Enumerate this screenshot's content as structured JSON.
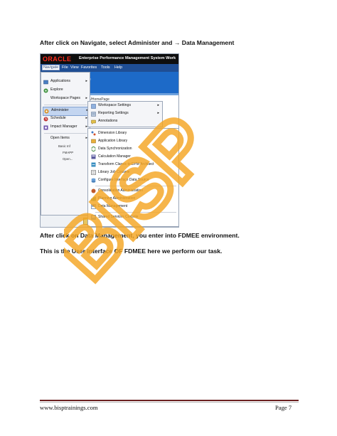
{
  "doc": {
    "para1": "After click on Navigate, select Administer and  → Data Management",
    "para2": "After click on Data Management, you enter into FDMEE environment.",
    "para3": "This is the User interface OF FDMEE here we perform our task."
  },
  "shot": {
    "brand": "ORACLE",
    "app_title": "Enterprise Performance Management System Work",
    "menubar": [
      "Navigate",
      "File",
      "View",
      "Favorites",
      "Tools",
      "Help"
    ],
    "blue_fragment": "e",
    "homepage_fragment": "s/HomePage",
    "navigate_menu": [
      {
        "label": "Applications",
        "icon": "applications-icon",
        "has_sub": true
      },
      {
        "label": "Explore",
        "icon": "explore-icon",
        "has_sub": false
      },
      {
        "label": "Workspace Pages",
        "icon": "",
        "has_sub": true
      },
      {
        "label": "Administer",
        "icon": "administer-icon",
        "has_sub": true
      },
      {
        "label": "Schedule",
        "icon": "schedule-icon",
        "has_sub": true
      },
      {
        "label": "Impact Manager",
        "icon": "impact-manager-icon",
        "has_sub": true
      },
      {
        "label": "Open Items",
        "icon": "",
        "has_sub": true
      }
    ],
    "open_windows": [
      "Basic Inf",
      "FMAPP",
      "Open..."
    ],
    "administer_submenu": [
      {
        "label": "Workspace Settings",
        "icon": "workspace-settings-icon",
        "has_sub": true
      },
      {
        "label": "Reporting Settings",
        "icon": "reporting-settings-icon",
        "has_sub": true
      },
      {
        "label": "Annotations",
        "icon": "annotations-icon",
        "has_sub": false
      }
    ],
    "third_menu": [
      {
        "label": "Dimension Library",
        "icon": "dimension-library-icon"
      },
      {
        "label": "Application Library",
        "icon": "application-library-icon"
      },
      {
        "label": "Data Synchronization",
        "icon": "data-sync-icon"
      },
      {
        "label": "Calculation Manager",
        "icon": "calculation-manager-icon"
      },
      {
        "label": "Transform Classic to EPM Architect",
        "icon": "transform-icon"
      },
      {
        "label": "Library Job Console",
        "icon": "job-console-icon"
      },
      {
        "label": "Configure Interface Data Source",
        "icon": "configure-source-icon"
      },
      {
        "label": "Consolidation Administration",
        "icon": "consolidation-icon"
      },
      {
        "label": "Planning Administration",
        "icon": "planning-icon"
      },
      {
        "label": "Data Management",
        "icon": "data-management-icon"
      },
      {
        "label": "Shared Services Console",
        "icon": "shared-services-icon"
      }
    ]
  },
  "watermark": {
    "text": "BISP",
    "color": "#f5a623"
  },
  "footer": {
    "site": "www.bisptrainings.com",
    "page": "Page 7"
  }
}
